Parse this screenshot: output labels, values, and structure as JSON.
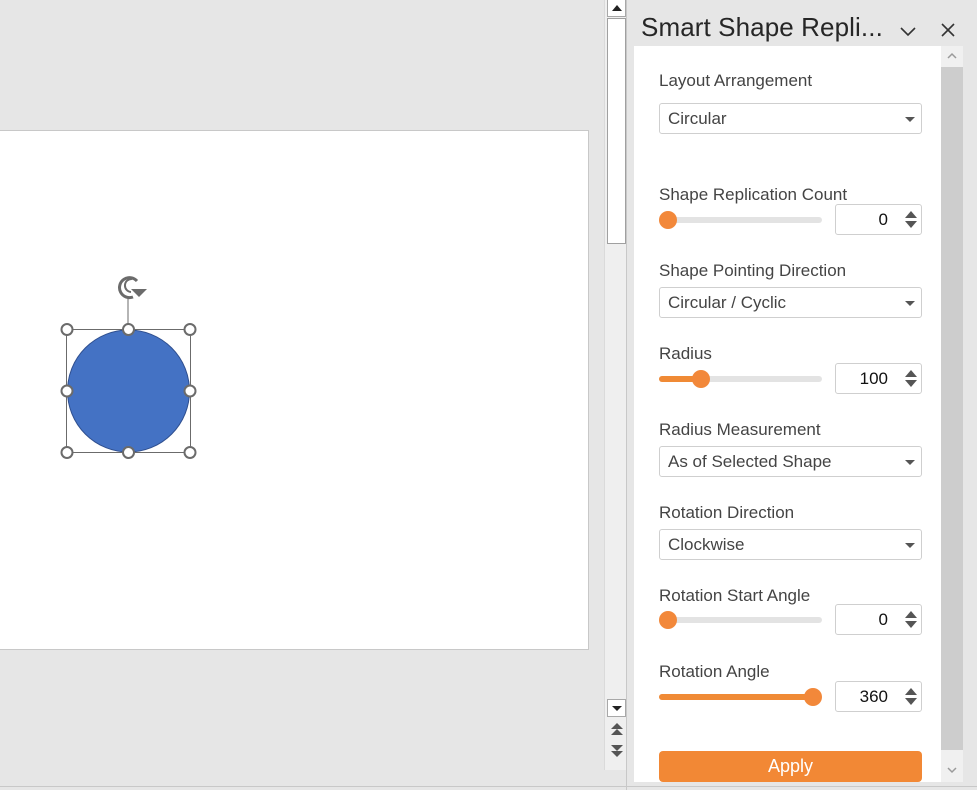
{
  "pane": {
    "title": "Smart Shape Repli...",
    "collapse_icon": "chevron-down-icon",
    "close_icon": "close-icon",
    "accent_color": "#f28835",
    "fields": {
      "layout_arrangement": {
        "label": "Layout Arrangement",
        "value": "Circular"
      },
      "replication_count": {
        "label": "Shape Replication Count",
        "value": "0",
        "slider_fraction": 0.0
      },
      "pointing_direction": {
        "label": "Shape Pointing Direction",
        "value": "Circular / Cyclic"
      },
      "radius": {
        "label": "Radius",
        "value": "100",
        "slider_fraction": 0.23
      },
      "radius_measurement": {
        "label": "Radius Measurement",
        "value": "As of Selected Shape"
      },
      "rotation_direction": {
        "label": "Rotation Direction",
        "value": "Clockwise"
      },
      "rotation_start_angle": {
        "label": "Rotation Start Angle",
        "value": "0",
        "slider_fraction": 0.0
      },
      "rotation_angle": {
        "label": "Rotation Angle",
        "value": "360",
        "slider_fraction": 1.0
      }
    },
    "apply_label": "Apply"
  },
  "slide": {
    "selected_shape": {
      "type": "circle",
      "fill": "#4472c4",
      "outline": "#2f4f8f"
    }
  },
  "editor_scrollbar": {
    "up_icon": "arrow-up-icon",
    "down_icon": "arrow-down-icon",
    "prev_slide_icon": "previous-slide-icon",
    "next_slide_icon": "next-slide-icon"
  }
}
